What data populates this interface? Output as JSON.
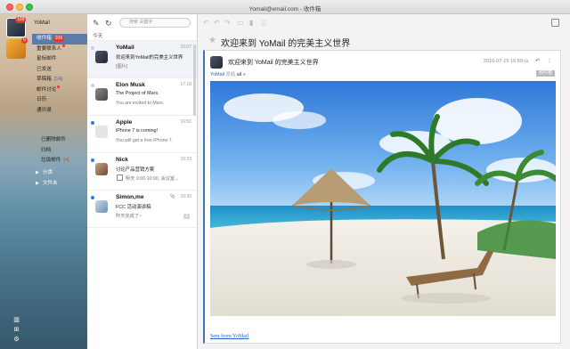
{
  "window": {
    "title": "Yomail@email.com - 收件箱"
  },
  "accounts": [
    {
      "name": "YoMail",
      "badge": "109"
    },
    {
      "badge": "6"
    }
  ],
  "folders": [
    {
      "label": "收件箱",
      "badge": "109",
      "active": true
    },
    {
      "label": "重要联系人",
      "dot": true
    },
    {
      "label": "星标邮件"
    },
    {
      "label": "已发送"
    },
    {
      "label": "草稿箱",
      "count": "[14]"
    },
    {
      "label": "邮件讨论",
      "dot": true
    },
    {
      "label": "日历"
    },
    {
      "label": "通讯录"
    }
  ],
  "subfolders": [
    {
      "label": "已删除邮件"
    },
    {
      "label": "归档"
    },
    {
      "label": "垃圾邮件",
      "count": "[4]"
    }
  ],
  "groups": [
    {
      "label": "分类"
    },
    {
      "label": "文件夹"
    }
  ],
  "list": {
    "search_placeholder": "搜索 关键字",
    "section_header": "今天",
    "messages": [
      {
        "sender": "YoMail",
        "time": "16:07",
        "subject": "欢迎来到YoMail的完美主义世界",
        "preview": "[图片]",
        "unread": false,
        "selected": true
      },
      {
        "sender": "Elon Musk",
        "time": "17:18",
        "subject": "The Project of Mars.",
        "preview": "You are invited to Mars.",
        "unread": false
      },
      {
        "sender": "Apple",
        "time": "16:50",
        "subject": "iPhone 7 is coming!",
        "preview": "You will get a free iPhone 7.",
        "unread": true
      },
      {
        "sender": "Nick",
        "time": "15:33",
        "subject": "讨论产品营销方案",
        "preview": "明天 9:00-10:00, 会议室...",
        "unread": true
      },
      {
        "sender": "Simon,me",
        "time": "15:30",
        "subject": "FCC 活动演讲稿",
        "preview": "昨天完成了~",
        "unread": true,
        "tag": "2"
      }
    ]
  },
  "reader": {
    "subject": "欢迎来到 YoMail 的完美主义世界",
    "card_subject": "欢迎来到 YoMail 的完美主义世界",
    "date": "2016-07-15 16:59",
    "from_name": "YoMail",
    "sent_to_label": "发给",
    "to": "all",
    "folder_tag": "收件箱",
    "footer_link": "Sent from YoMail"
  },
  "colors": {
    "accent": "#3b76c5",
    "badge": "#e8392f",
    "unread_dot": "#2f7de1"
  }
}
